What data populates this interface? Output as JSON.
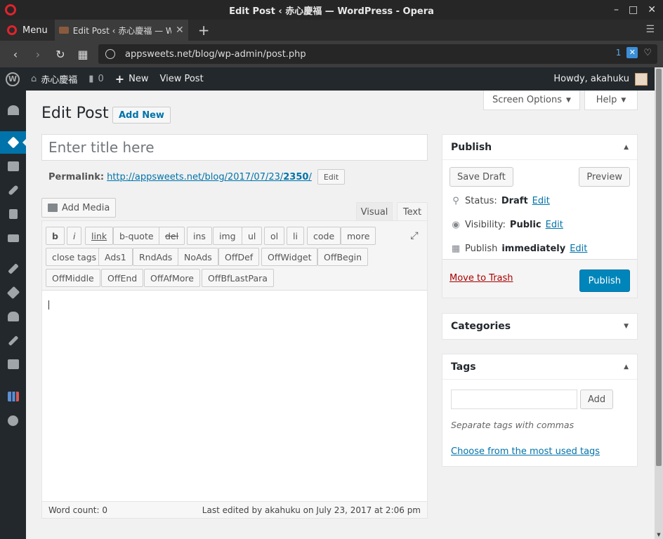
{
  "window": {
    "title": "Edit Post ‹ 赤心慶福 — WordPress - Opera",
    "minimize": "–",
    "maximize": "□",
    "close": "✕"
  },
  "browser": {
    "menu_label": "Menu",
    "tab_title": "Edit Post ‹ 赤心慶福 — Wo",
    "tab_close": "✕",
    "new_tab": "+",
    "url": "appsweets.net/blog/wp-admin/post.php",
    "adblock_count": "1"
  },
  "adminbar": {
    "site_name": "赤心慶福",
    "comments_count": "0",
    "new_label": "New",
    "view_post": "View Post",
    "howdy": "Howdy, akahuku"
  },
  "header": {
    "screen_options": "Screen Options",
    "help": "Help",
    "page_title": "Edit Post",
    "add_new": "Add New"
  },
  "post": {
    "title_placeholder": "Enter title here",
    "permalink_label": "Permalink:",
    "permalink_prefix": "http://appsweets.net/blog/2017/07/23/",
    "permalink_slug": "2350",
    "permalink_suffix": "/",
    "permalink_edit": "Edit"
  },
  "editor": {
    "add_media": "Add Media",
    "tab_visual": "Visual",
    "tab_text": "Text",
    "quicktags": [
      "b",
      "i",
      "link",
      "b-quote",
      "del",
      "ins",
      "img",
      "ul",
      "ol",
      "li",
      "code",
      "more",
      "close tags",
      "Ads1",
      "RndAds",
      "NoAds",
      "OffDef",
      "OffWidget",
      "OffBegin",
      "OffMiddle",
      "OffEnd",
      "OffAfMore",
      "OffBfLastPara"
    ],
    "word_count": "Word count: 0",
    "last_edited": "Last edited by akahuku on July 23, 2017 at 2:06 pm"
  },
  "publish": {
    "title": "Publish",
    "save_draft": "Save Draft",
    "preview": "Preview",
    "status_label": "Status:",
    "status_value": "Draft",
    "visibility_label": "Visibility:",
    "visibility_value": "Public",
    "publish_label": "Publish",
    "publish_value": "immediately",
    "edit": "Edit",
    "move_to_trash": "Move to Trash",
    "publish_button": "Publish"
  },
  "categories": {
    "title": "Categories"
  },
  "tags": {
    "title": "Tags",
    "add": "Add",
    "hint": "Separate tags with commas",
    "choose": "Choose from the most used tags"
  },
  "colors": {
    "accent": "#0073aa",
    "primary_button": "#0085ba",
    "admin_bar": "#23282d",
    "trash": "#aa0000"
  }
}
